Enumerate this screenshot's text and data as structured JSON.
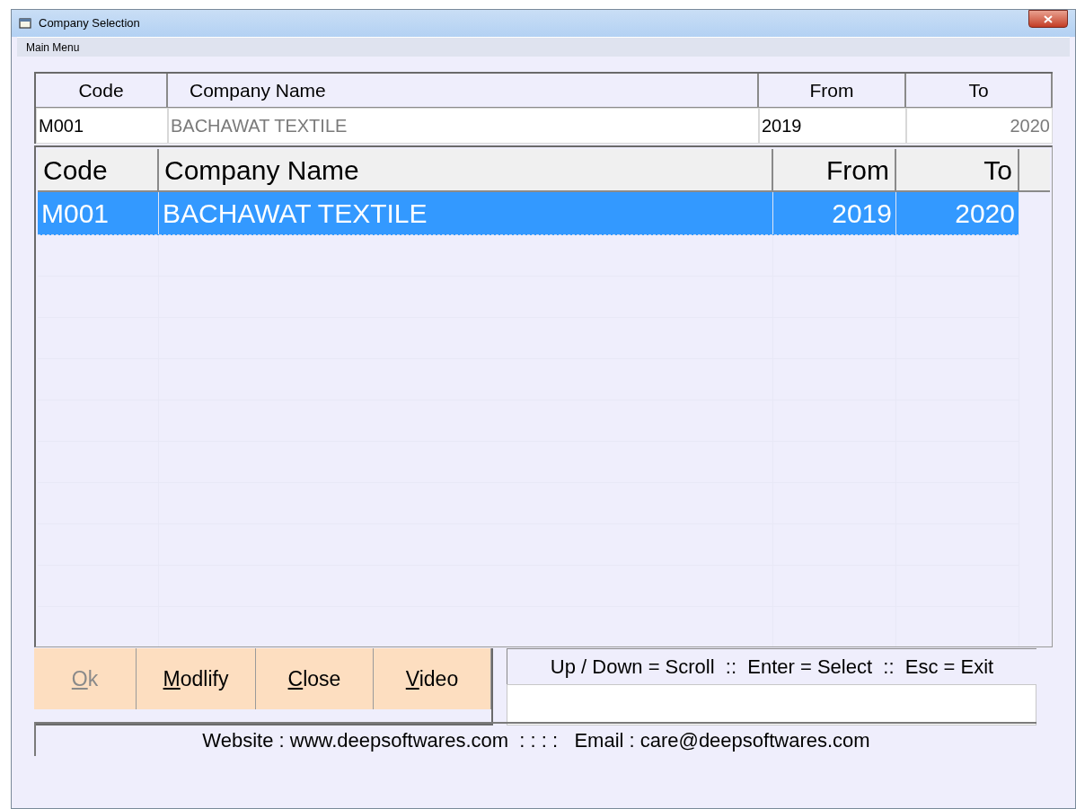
{
  "window": {
    "title": "Company Selection"
  },
  "menu": [
    "Main Menu"
  ],
  "header_fields": {
    "columns": [
      "Code",
      "Company Name",
      "From",
      "To"
    ],
    "values": [
      {
        "text": "M001",
        "muted": false
      },
      {
        "text": "BACHAWAT TEXTILE",
        "muted": true
      },
      {
        "text": "2019",
        "muted": false
      },
      {
        "text": "2020",
        "muted": true
      }
    ]
  },
  "table": {
    "columns": [
      "Code",
      "Company Name",
      "From",
      "To"
    ],
    "rows": [
      {
        "selected": true,
        "cells": [
          "M001",
          "BACHAWAT TEXTILE",
          "2019",
          "2020"
        ]
      }
    ]
  },
  "buttons": [
    {
      "label": "Ok",
      "disabled": true,
      "underline_first": true
    },
    {
      "label": "Modlify",
      "disabled": false,
      "underline_first": true
    },
    {
      "label": "Close",
      "disabled": false,
      "underline_first": true
    },
    {
      "label": "Video",
      "disabled": false,
      "underline_first": true
    }
  ],
  "hint": "Up / Down = Scroll  ::  Enter = Select  ::  Esc = Exit",
  "footer": "Website : www.deepsoftwares.com  : : : :   Email : care@deepsoftwares.com"
}
